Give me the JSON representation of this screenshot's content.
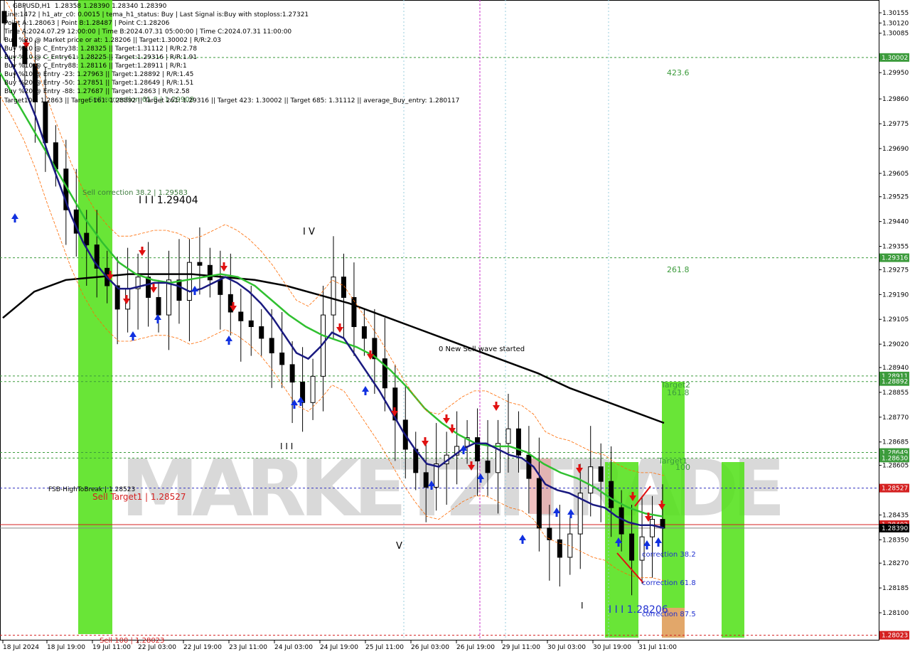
{
  "header": {
    "symbol": "GBPUSD,H1",
    "ohlc": "1.28358 1.28390 1.28340 1.28390"
  },
  "info_lines": [
    "Line:1472 | h1_atr_c0: 0.0015 | tema_h1_status: Buy | Last Signal is:Buy with stoploss:1.27321",
    "Point A:1.28063 | Point B:1.28487 | Point C:1.28206",
    "Time A:2024.07.29 12:00:00 | Time B:2024.07.31 05:00:00 | Time C:2024.07.31 11:00:00",
    "Buy %20 @ Market price or at: 1.28206 || Target:1.30002 | R/R:2.03",
    "Buy %10 @ C_Entry38: 1.28325 || Target:1.31112 | R/R:2.78",
    "Buy %10 @ C_Entry61: 1.28225 || Target:1.29316 | R/R:1.91",
    "Buy %10 @ C_Entry88: 1.28116 || Target:1.28911 | R/R:1",
    "Buy %10 @ Entry -23: 1.27963 || Target:1.28892 | R/R:1.45",
    "Buy %20 @ Entry -50: 1.27851 || Target:1.28649 | R/R:1.51",
    "Buy %20 @ Entry -88: 1.27687 || Target:1.2863 | R/R:2.58",
    "Target100: 1.2863 || Target 161: 1.28892 || Target 261: 1.29316 || Target 423: 1.30002 || Target 685: 1.31112 || average_Buy_entry: 1.280117"
  ],
  "price_axis": {
    "ticks": [
      "1.30155",
      "1.30120",
      "1.30085",
      "1.29950",
      "1.29860",
      "1.29775",
      "1.29690",
      "1.29605",
      "1.29525",
      "1.29440",
      "1.29355",
      "1.29275",
      "1.29190",
      "1.29105",
      "1.29020",
      "1.28940",
      "1.28855",
      "1.28770",
      "1.28685",
      "1.28605",
      "1.28435",
      "1.28350",
      "1.28270",
      "1.28185",
      "1.28100"
    ],
    "tick_values": [
      1.30155,
      1.3012,
      1.30085,
      1.2995,
      1.2986,
      1.29775,
      1.2969,
      1.29605,
      1.29525,
      1.2944,
      1.29355,
      1.29275,
      1.2919,
      1.29105,
      1.2902,
      1.2894,
      1.28855,
      1.2877,
      1.28685,
      1.28605,
      1.28435,
      1.2835,
      1.2827,
      1.28185,
      1.281
    ],
    "badges": [
      {
        "text": "1.30002",
        "value": 1.30002,
        "color": "#3c9b3c"
      },
      {
        "text": "1.29316",
        "value": 1.29316,
        "color": "#3c9b3c"
      },
      {
        "text": "1.28911",
        "value": 1.28911,
        "color": "#3c9b3c"
      },
      {
        "text": "1.28892",
        "value": 1.28892,
        "color": "#3c9b3c"
      },
      {
        "text": "1.28649",
        "value": 1.28649,
        "color": "#3c9b3c"
      },
      {
        "text": "1.28630",
        "value": 1.2863,
        "color": "#3c9b3c"
      },
      {
        "text": "1.28527",
        "value": 1.28527,
        "color": "#d42020"
      },
      {
        "text": "1.28402",
        "value": 1.28402,
        "color": "#d42020"
      },
      {
        "text": "1.28390",
        "value": 1.2839,
        "color": "#000000"
      },
      {
        "text": "1.28023",
        "value": 1.28023,
        "color": "#d42020"
      }
    ]
  },
  "time_axis": [
    "18 Jul 2024",
    "18 Jul 19:00",
    "19 Jul 11:00",
    "22 Jul 03:00",
    "22 Jul 19:00",
    "23 Jul 11:00",
    "24 Jul 03:00",
    "24 Jul 19:00",
    "25 Jul 11:00",
    "26 Jul 03:00",
    "26 Jul 19:00",
    "29 Jul 11:00",
    "30 Jul 03:00",
    "30 Jul 19:00",
    "31 Jul 11:00"
  ],
  "annotations": {
    "fib_423": "423.6",
    "fib_261": "261.8",
    "target2": "Target2",
    "fib_161": "161.8",
    "target1": "Target1",
    "fib_100": "100",
    "sell_correction": "Sell correction 38.2 | 1.29583",
    "sell_correction_2": "Sell correction 61.8 | 1.29908",
    "wave_level": "I I I 1.29404",
    "wave_iv": "I V",
    "wave_iii": "I I I",
    "wave_v": "V",
    "new_sell_wave": "0 New Sell wave started",
    "fsb_high": "FSB-HighToBreak | 1.28523",
    "sell_target": "Sell Target1 | 1.28527",
    "sell_100": "Sell 100 | 1.28023",
    "correction_382": "correction 38.2",
    "correction_618": "correction 61.8",
    "correction_875": "correction 87.5",
    "wave_c_level": "I I I 1.28206",
    "wave_i": "I"
  },
  "watermark": "MARKETZITRADE",
  "chart_data": {
    "type": "candlestick",
    "title": "GBPUSD,H1",
    "ylim": [
      1.28,
      1.3021
    ],
    "x_range": [
      "18 Jul 2024",
      "31 Jul 2024 11:00"
    ],
    "close_series": [
      1.3012,
      1.3004,
      1.2998,
      1.2985,
      1.2971,
      1.2962,
      1.2948,
      1.294,
      1.2936,
      1.2928,
      1.2922,
      1.2914,
      1.2921,
      1.2925,
      1.2918,
      1.2912,
      1.2924,
      1.2917,
      1.293,
      1.2929,
      1.2924,
      1.2919,
      1.2913,
      1.291,
      1.2908,
      1.2904,
      1.2899,
      1.2895,
      1.2889,
      1.2882,
      1.2891,
      1.2912,
      1.2925,
      1.2918,
      1.2908,
      1.2904,
      1.2897,
      1.2887,
      1.2876,
      1.2866,
      1.2858,
      1.2853,
      1.2861,
      1.2864,
      1.2867,
      1.287,
      1.2862,
      1.2858,
      1.2868,
      1.2873,
      1.2864,
      1.2856,
      1.2839,
      1.2835,
      1.2829,
      1.2837,
      1.2851,
      1.286,
      1.2855,
      1.2846,
      1.2837,
      1.2828,
      1.2836,
      1.2842,
      1.2839
    ],
    "ema_fast": [
      1.3005,
      1.2998,
      1.299,
      1.298,
      1.2968,
      1.2957,
      1.2946,
      1.2937,
      1.293,
      1.2925,
      1.2921,
      1.2921,
      1.2922,
      1.2923,
      1.2923,
      1.2922,
      1.292,
      1.2921,
      1.2923,
      1.2925,
      1.2923,
      1.292,
      1.2916,
      1.2911,
      1.2905,
      1.2899,
      1.2897,
      1.2901,
      1.2906,
      1.2904,
      1.2898,
      1.2892,
      1.2886,
      1.2879,
      1.2872,
      1.2866,
      1.2861,
      1.286,
      1.2863,
      1.2866,
      1.2868,
      1.2868,
      1.2866,
      1.2864,
      1.2863,
      1.286,
      1.2854,
      1.2852,
      1.2851,
      1.2849,
      1.2847,
      1.2846,
      1.2843,
      1.2841,
      1.284,
      1.284,
      1.2839
    ],
    "ema_mid": [
      1.2995,
      1.2985,
      1.2975,
      1.2965,
      1.2955,
      1.2945,
      1.2937,
      1.293,
      1.2926,
      1.2924,
      1.2923,
      1.2924,
      1.2925,
      1.2926,
      1.2925,
      1.2922,
      1.2917,
      1.2912,
      1.2908,
      1.2905,
      1.2903,
      1.2901,
      1.2898,
      1.2893,
      1.2887,
      1.288,
      1.2875,
      1.2871,
      1.2868,
      1.2867,
      1.2867,
      1.2865,
      1.2861,
      1.2858,
      1.2856,
      1.2853,
      1.2849,
      1.2846,
      1.2844,
      1.2843
    ],
    "ema_slow": [
      1.2911,
      1.292,
      1.2924,
      1.2925,
      1.2926,
      1.2926,
      1.2926,
      1.2925,
      1.2924,
      1.2922,
      1.2919,
      1.2916,
      1.2912,
      1.2908,
      1.2904,
      1.29,
      1.2896,
      1.2892,
      1.2887,
      1.2883,
      1.2879,
      1.2875
    ]
  }
}
